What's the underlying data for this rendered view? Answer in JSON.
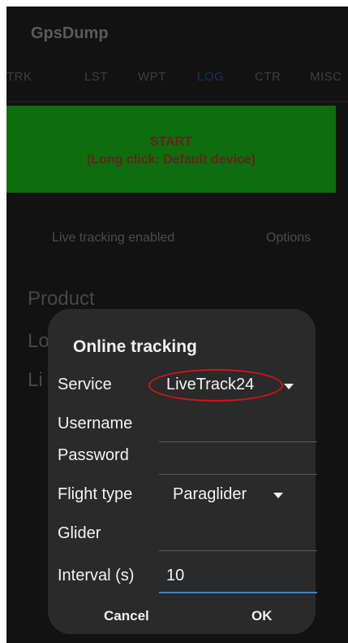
{
  "app": {
    "title": "GpsDump"
  },
  "tabs": [
    {
      "label": "TRK"
    },
    {
      "label": "LST"
    },
    {
      "label": "WPT"
    },
    {
      "label": "LOG"
    },
    {
      "label": "CTR"
    },
    {
      "label": "MISC"
    }
  ],
  "active_tab": "LOG",
  "start_button": {
    "line1": "START",
    "line2": "(Long click: Default device)"
  },
  "live_tracking_label": "Live tracking enabled",
  "options_label": "Options",
  "background_items": {
    "product": "Product",
    "item2": "Lo",
    "item3": "Li"
  },
  "dialog": {
    "title": "Online tracking",
    "service": {
      "label": "Service",
      "value": "LiveTrack24"
    },
    "username": {
      "label": "Username",
      "value": ""
    },
    "password": {
      "label": "Password",
      "value": ""
    },
    "flight_type": {
      "label": "Flight type",
      "value": "Paraglider"
    },
    "glider": {
      "label": "Glider",
      "value": ""
    },
    "interval": {
      "label": "Interval (s)",
      "value": "10"
    },
    "cancel_label": "Cancel",
    "ok_label": "OK"
  },
  "colors": {
    "start_button_bg": "#0c6e0c",
    "dialog_bg": "#2a2a2a",
    "focus_underline": "#3b82c4",
    "highlight_ellipse": "#d4131b"
  }
}
